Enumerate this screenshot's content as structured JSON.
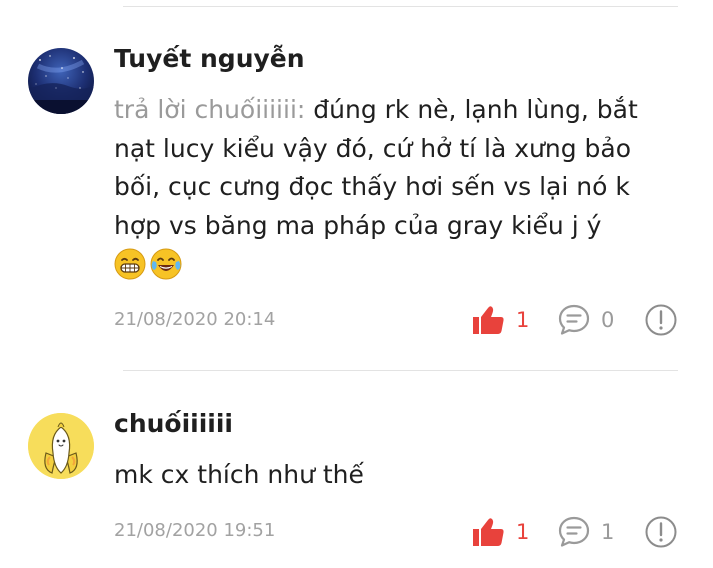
{
  "comments": [
    {
      "username": "Tuyết nguyễn",
      "reply_prefix": "trả lời chuốiiiiii:",
      "text": " đúng rk nè, lạnh lùng, bắt nạt lucy kiểu vậy đó, cứ hở tí là xưng bảo bối, cục cưng đọc thấy hơi sến vs lại nó k hợp vs băng ma pháp của gray kiểu j ý",
      "emojis": [
        "grinning-teeth-emoji",
        "tears-of-joy-emoji"
      ],
      "timestamp": "21/08/2020 20:14",
      "likes": "1",
      "replies": "0",
      "avatar": "starry-night-sky"
    },
    {
      "username": "chuốiiiiii",
      "reply_prefix": "",
      "text": "mk cx thích như thế",
      "emojis": [],
      "timestamp": "21/08/2020 19:51",
      "likes": "1",
      "replies": "1",
      "avatar": "cartoon-banana"
    }
  ],
  "icons": {
    "like": "thumbs-up-icon",
    "reply": "chat-bubble-icon",
    "report": "exclamation-circle-icon"
  },
  "colors": {
    "like_active": "#e8423c",
    "muted_text": "#a2a2a2",
    "icon_gray": "#9a9a9a",
    "divider": "#e3e3e3"
  }
}
